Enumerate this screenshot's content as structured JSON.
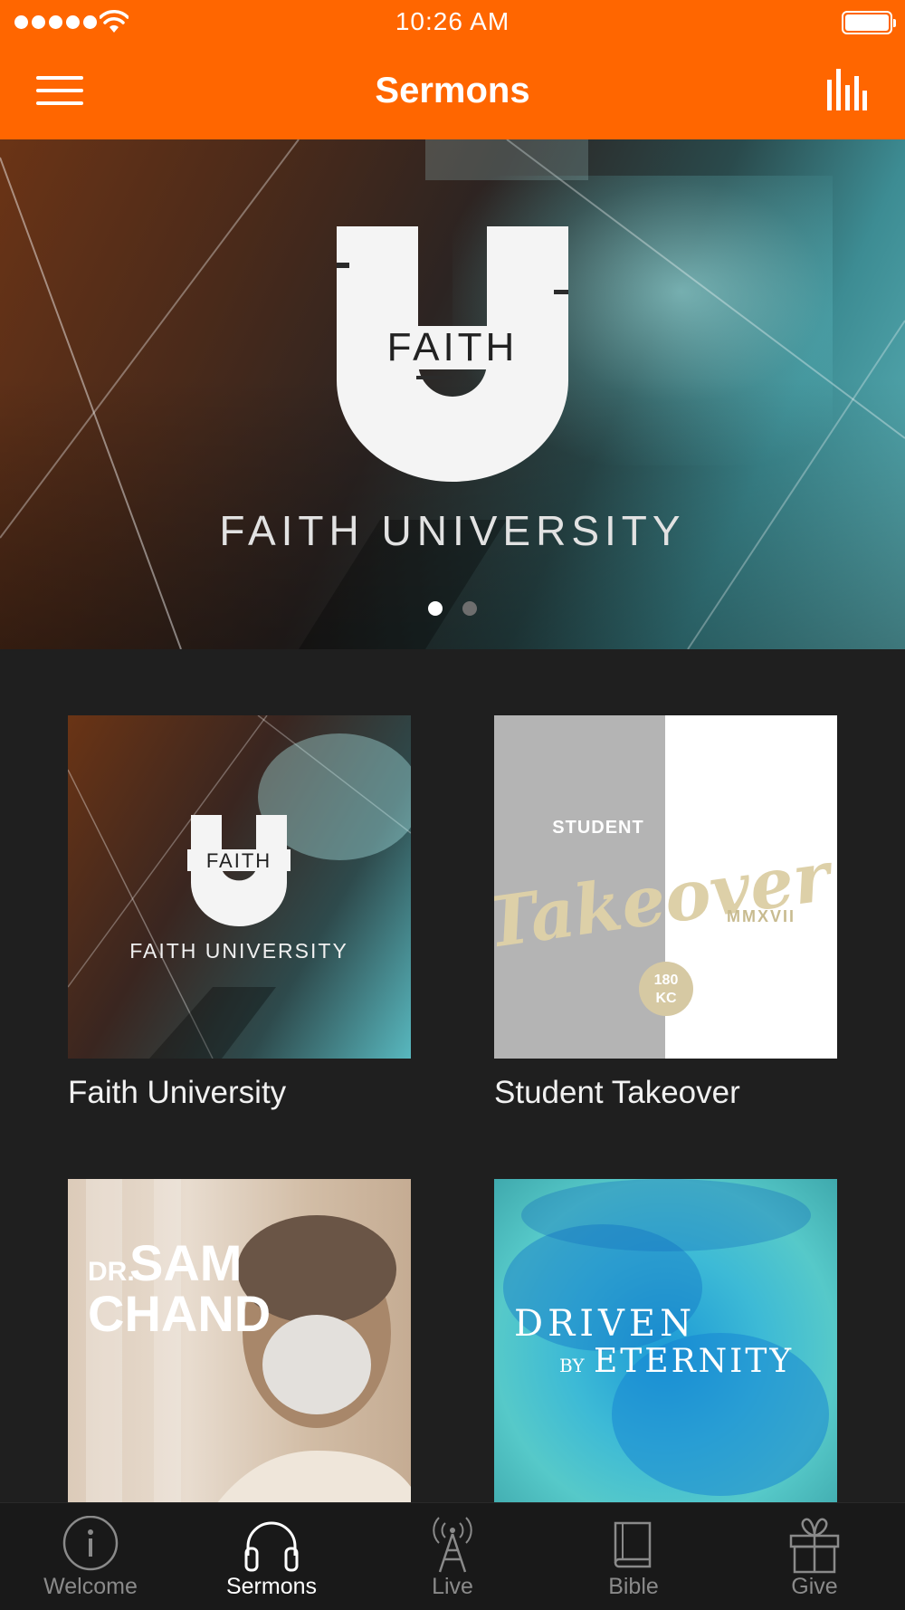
{
  "status_bar": {
    "time": "10:26 AM",
    "signal_bars": 5,
    "battery_level": 1.0,
    "icons": [
      "signal-dots-icon",
      "wifi-icon",
      "battery-icon"
    ]
  },
  "navbar": {
    "title": "Sermons",
    "left_icon": "hamburger-menu-icon",
    "right_icon": "equalizer-icon"
  },
  "hero": {
    "caption": "FAITH UNIVERSITY",
    "logo_text": "FAITH",
    "page_count": 2,
    "current_page": 1
  },
  "series": [
    {
      "label": "Faith University",
      "art_text": "FAITH UNIVERSITY",
      "art_logo": "FAITH"
    },
    {
      "label": "Student Takeover",
      "art_top": "STUDENT",
      "art_script": "Takeover",
      "art_roman": "MMXVII",
      "art_badge_1": "180",
      "art_badge_2": "KC"
    },
    {
      "label": "",
      "art_dr": "DR.",
      "art_name_1": "SAM",
      "art_name_2": "CHAND"
    },
    {
      "label": "",
      "art_line_1": "DRIVEN",
      "art_by": "BY",
      "art_line_2": "ETERNITY"
    }
  ],
  "tabbar": {
    "tabs": [
      {
        "label": "Welcome",
        "icon": "info-icon",
        "active": false
      },
      {
        "label": "Sermons",
        "icon": "headphones-icon",
        "active": true
      },
      {
        "label": "Live",
        "icon": "broadcast-tower-icon",
        "active": false
      },
      {
        "label": "Bible",
        "icon": "book-icon",
        "active": false
      },
      {
        "label": "Give",
        "icon": "gift-icon",
        "active": false
      }
    ]
  },
  "colors": {
    "accent": "#ff6600",
    "background": "#1f1f1f",
    "tabbar": "#191919",
    "tab_inactive": "#8a8a8a",
    "tab_active": "#ffffff"
  }
}
